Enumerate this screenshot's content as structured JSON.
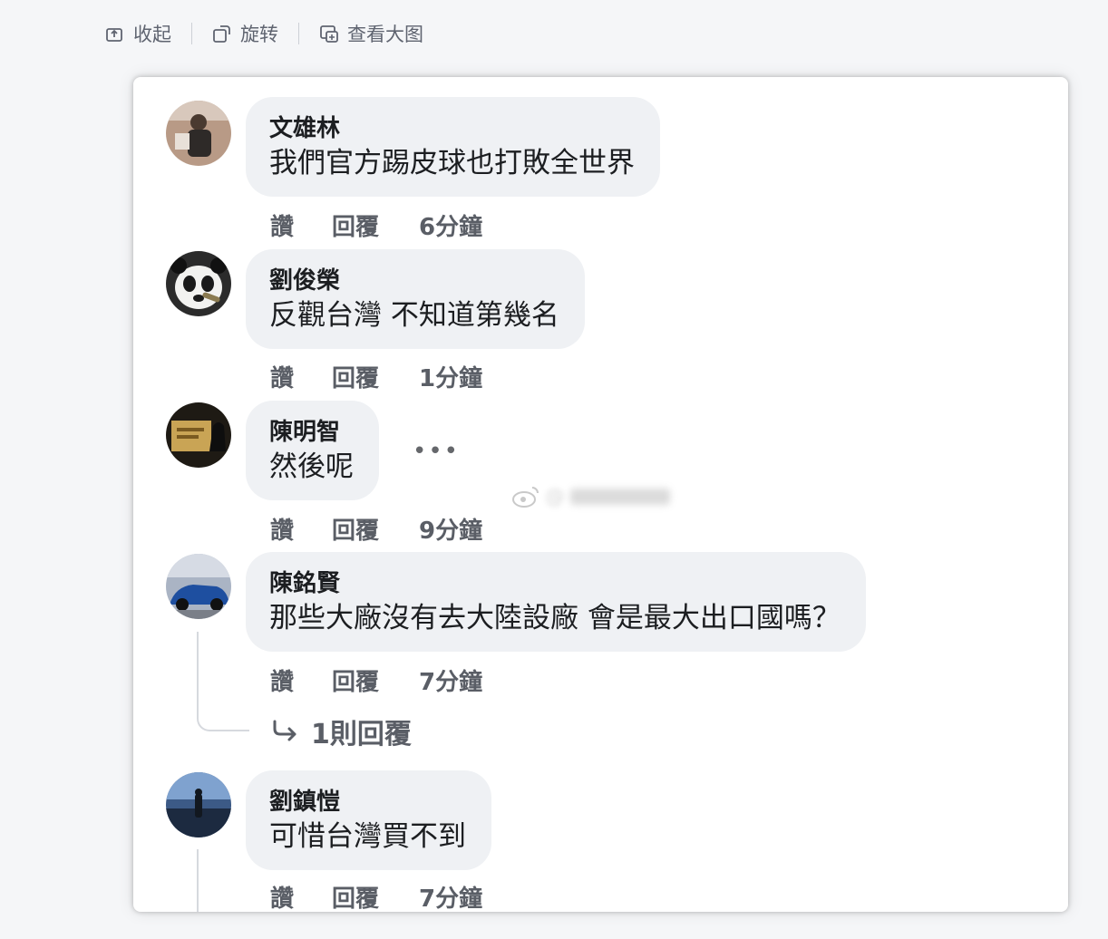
{
  "toolbar": {
    "collapse_label": "收起",
    "rotate_label": "旋转",
    "view_large_label": "查看大图"
  },
  "comments": [
    {
      "name": "文雄林",
      "text": "我們官方踢皮球也打敗全世界",
      "like": "讚",
      "reply": "回覆",
      "time": "6分鐘"
    },
    {
      "name": "劉俊榮",
      "text": "反觀台灣 不知道第幾名",
      "like": "讚",
      "reply": "回覆",
      "time": "1分鐘"
    },
    {
      "name": "陳明智",
      "text": "然後呢",
      "like": "讚",
      "reply": "回覆",
      "time": "9分鐘",
      "more": "•••"
    },
    {
      "name": "陳銘賢",
      "text": "那些大廠沒有去大陸設廠 會是最大出口國嗎？",
      "like": "讚",
      "reply": "回覆",
      "time": "7分鐘",
      "replies_link": "1則回覆"
    },
    {
      "name": "劉鎮愷",
      "text": "可惜台灣買不到",
      "like": "讚",
      "reply": "回覆",
      "time": "7分鐘"
    }
  ],
  "watermark_text": "@"
}
